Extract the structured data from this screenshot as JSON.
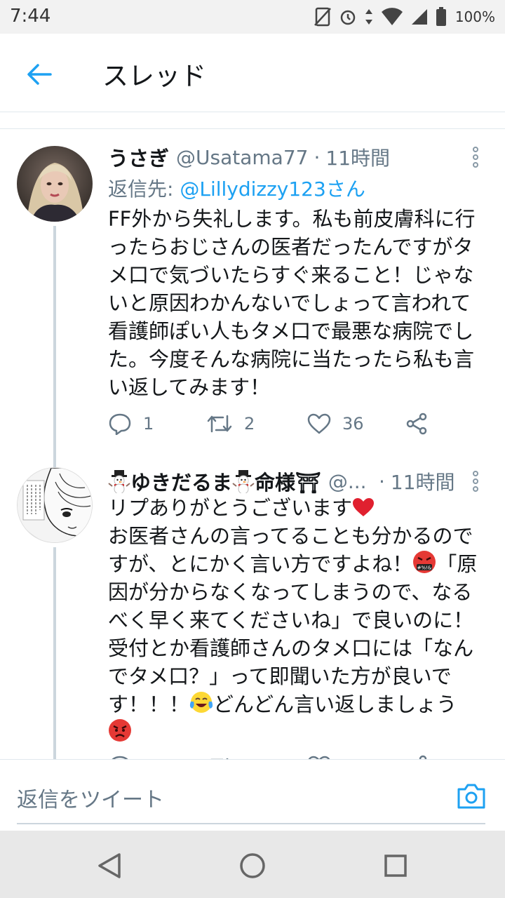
{
  "status_bar": {
    "time": "7:44",
    "battery": "100%"
  },
  "header": {
    "title": "スレッド"
  },
  "tweets": [
    {
      "name": "うさぎ",
      "handle": "@Usatama77",
      "time": "11時間",
      "reply_prefix": "返信先: ",
      "reply_to": "@Lillydizzy123さん",
      "text": "FF外から失礼します。私も前皮膚科に行ったらおじさんの医者だったんですがタメ口で気づいたらすぐ来ること！じゃないと原因わかんないでしょって言われて看護師ぽい人もタメ口で最悪な病院でした。今度そんな病院に当たったら私も言い返してみます！",
      "replies": "1",
      "retweets": "2",
      "likes": "36"
    },
    {
      "name": "ゆきだるま",
      "name_suffix": "命様⛩",
      "handle": "@...",
      "time": "11時間",
      "text_1": "リプありがとうございます",
      "text_2": "お医者さんの言ってることも分かるのですが、とにかく言い方ですよね！",
      "text_3": "「原因が分からなくなってしまうので、なるべく早く来てくださいね」で良いのに！受付とか看護師さんのタメ口には「なんでタメ口？」って即聞いた方が良いです！！！",
      "text_4": "どんどん言い返しましょう"
    }
  ],
  "composer": {
    "placeholder": "返信をツイート"
  },
  "icons": {
    "back": "arrow-left-icon",
    "more": "more-vertical-icon",
    "reply": "reply-icon",
    "retweet": "retweet-icon",
    "like": "heart-icon",
    "share": "share-icon",
    "camera": "camera-icon"
  },
  "colors": {
    "accent": "#1da1f2",
    "secondary_text": "#657786",
    "text": "#14171a"
  }
}
